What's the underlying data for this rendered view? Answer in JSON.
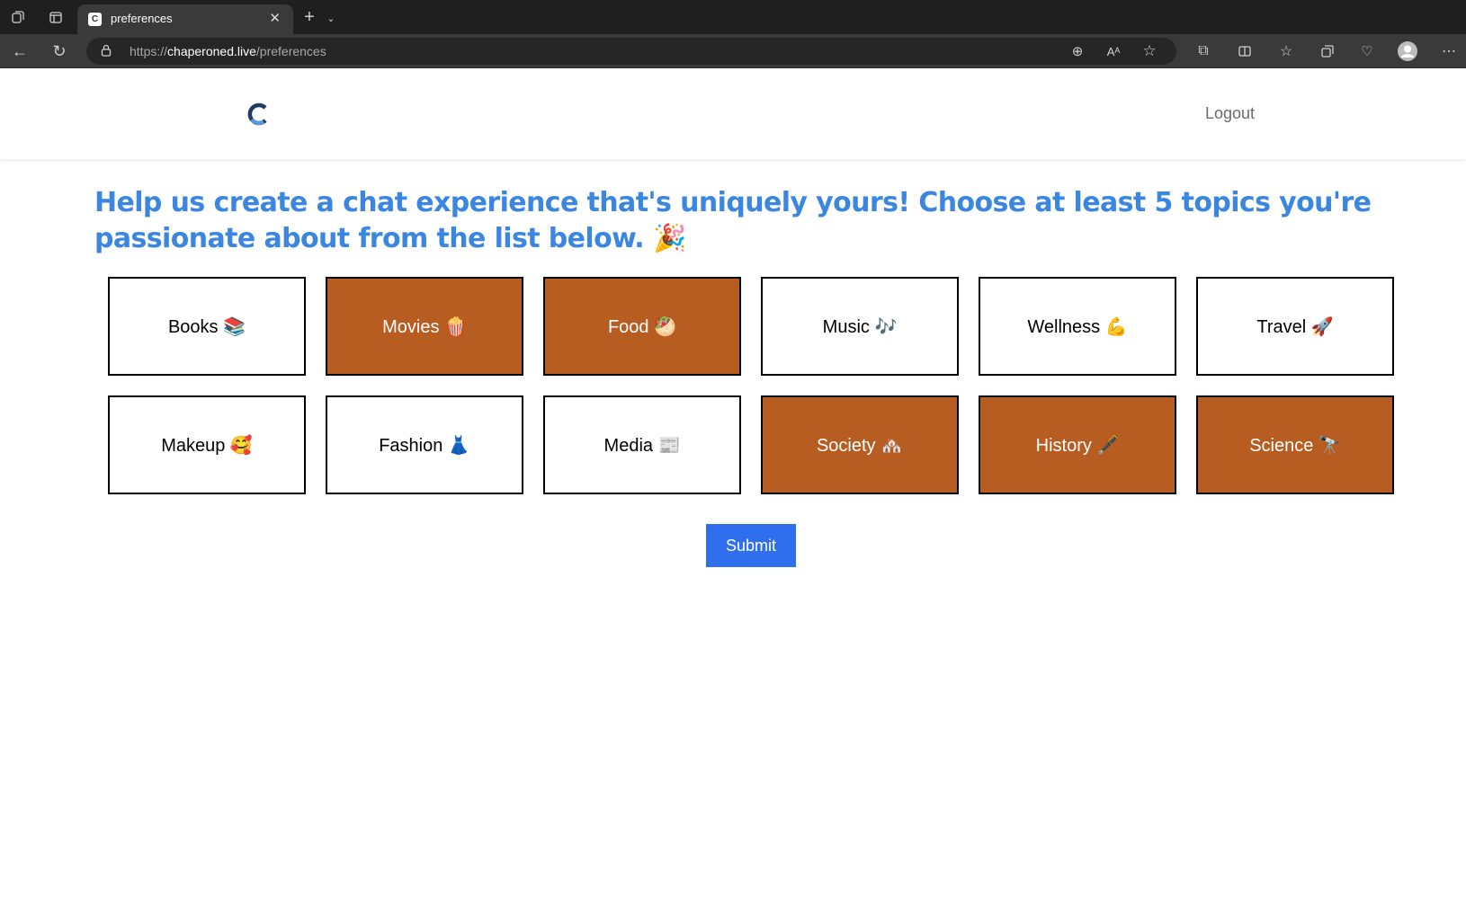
{
  "browser": {
    "tab_title": "preferences",
    "favicon_letter": "C",
    "url_scheme": "https://",
    "url_host": "chaperoned.live",
    "url_path": "/preferences"
  },
  "header": {
    "logout_label": "Logout"
  },
  "main": {
    "headline": "Help us create a chat experience that's uniquely yours! Choose at least 5 topics you're passionate about from the list below. 🎉",
    "topics": [
      {
        "label": "Books 📚",
        "selected": false
      },
      {
        "label": "Movies 🍿",
        "selected": true
      },
      {
        "label": "Food 🥙",
        "selected": true
      },
      {
        "label": "Music 🎶",
        "selected": false
      },
      {
        "label": "Wellness 💪",
        "selected": false
      },
      {
        "label": "Travel 🚀",
        "selected": false
      },
      {
        "label": "Makeup 🥰",
        "selected": false
      },
      {
        "label": "Fashion 👗",
        "selected": false
      },
      {
        "label": "Media 📰",
        "selected": false
      },
      {
        "label": "Society 🏘️",
        "selected": true
      },
      {
        "label": "History 🖋️",
        "selected": true
      },
      {
        "label": "Science 🔭",
        "selected": true
      }
    ],
    "submit_label": "Submit"
  },
  "colors": {
    "headline": "#3b86e0",
    "selected_topic": "#b75d22",
    "submit_button": "#2f6fed"
  }
}
